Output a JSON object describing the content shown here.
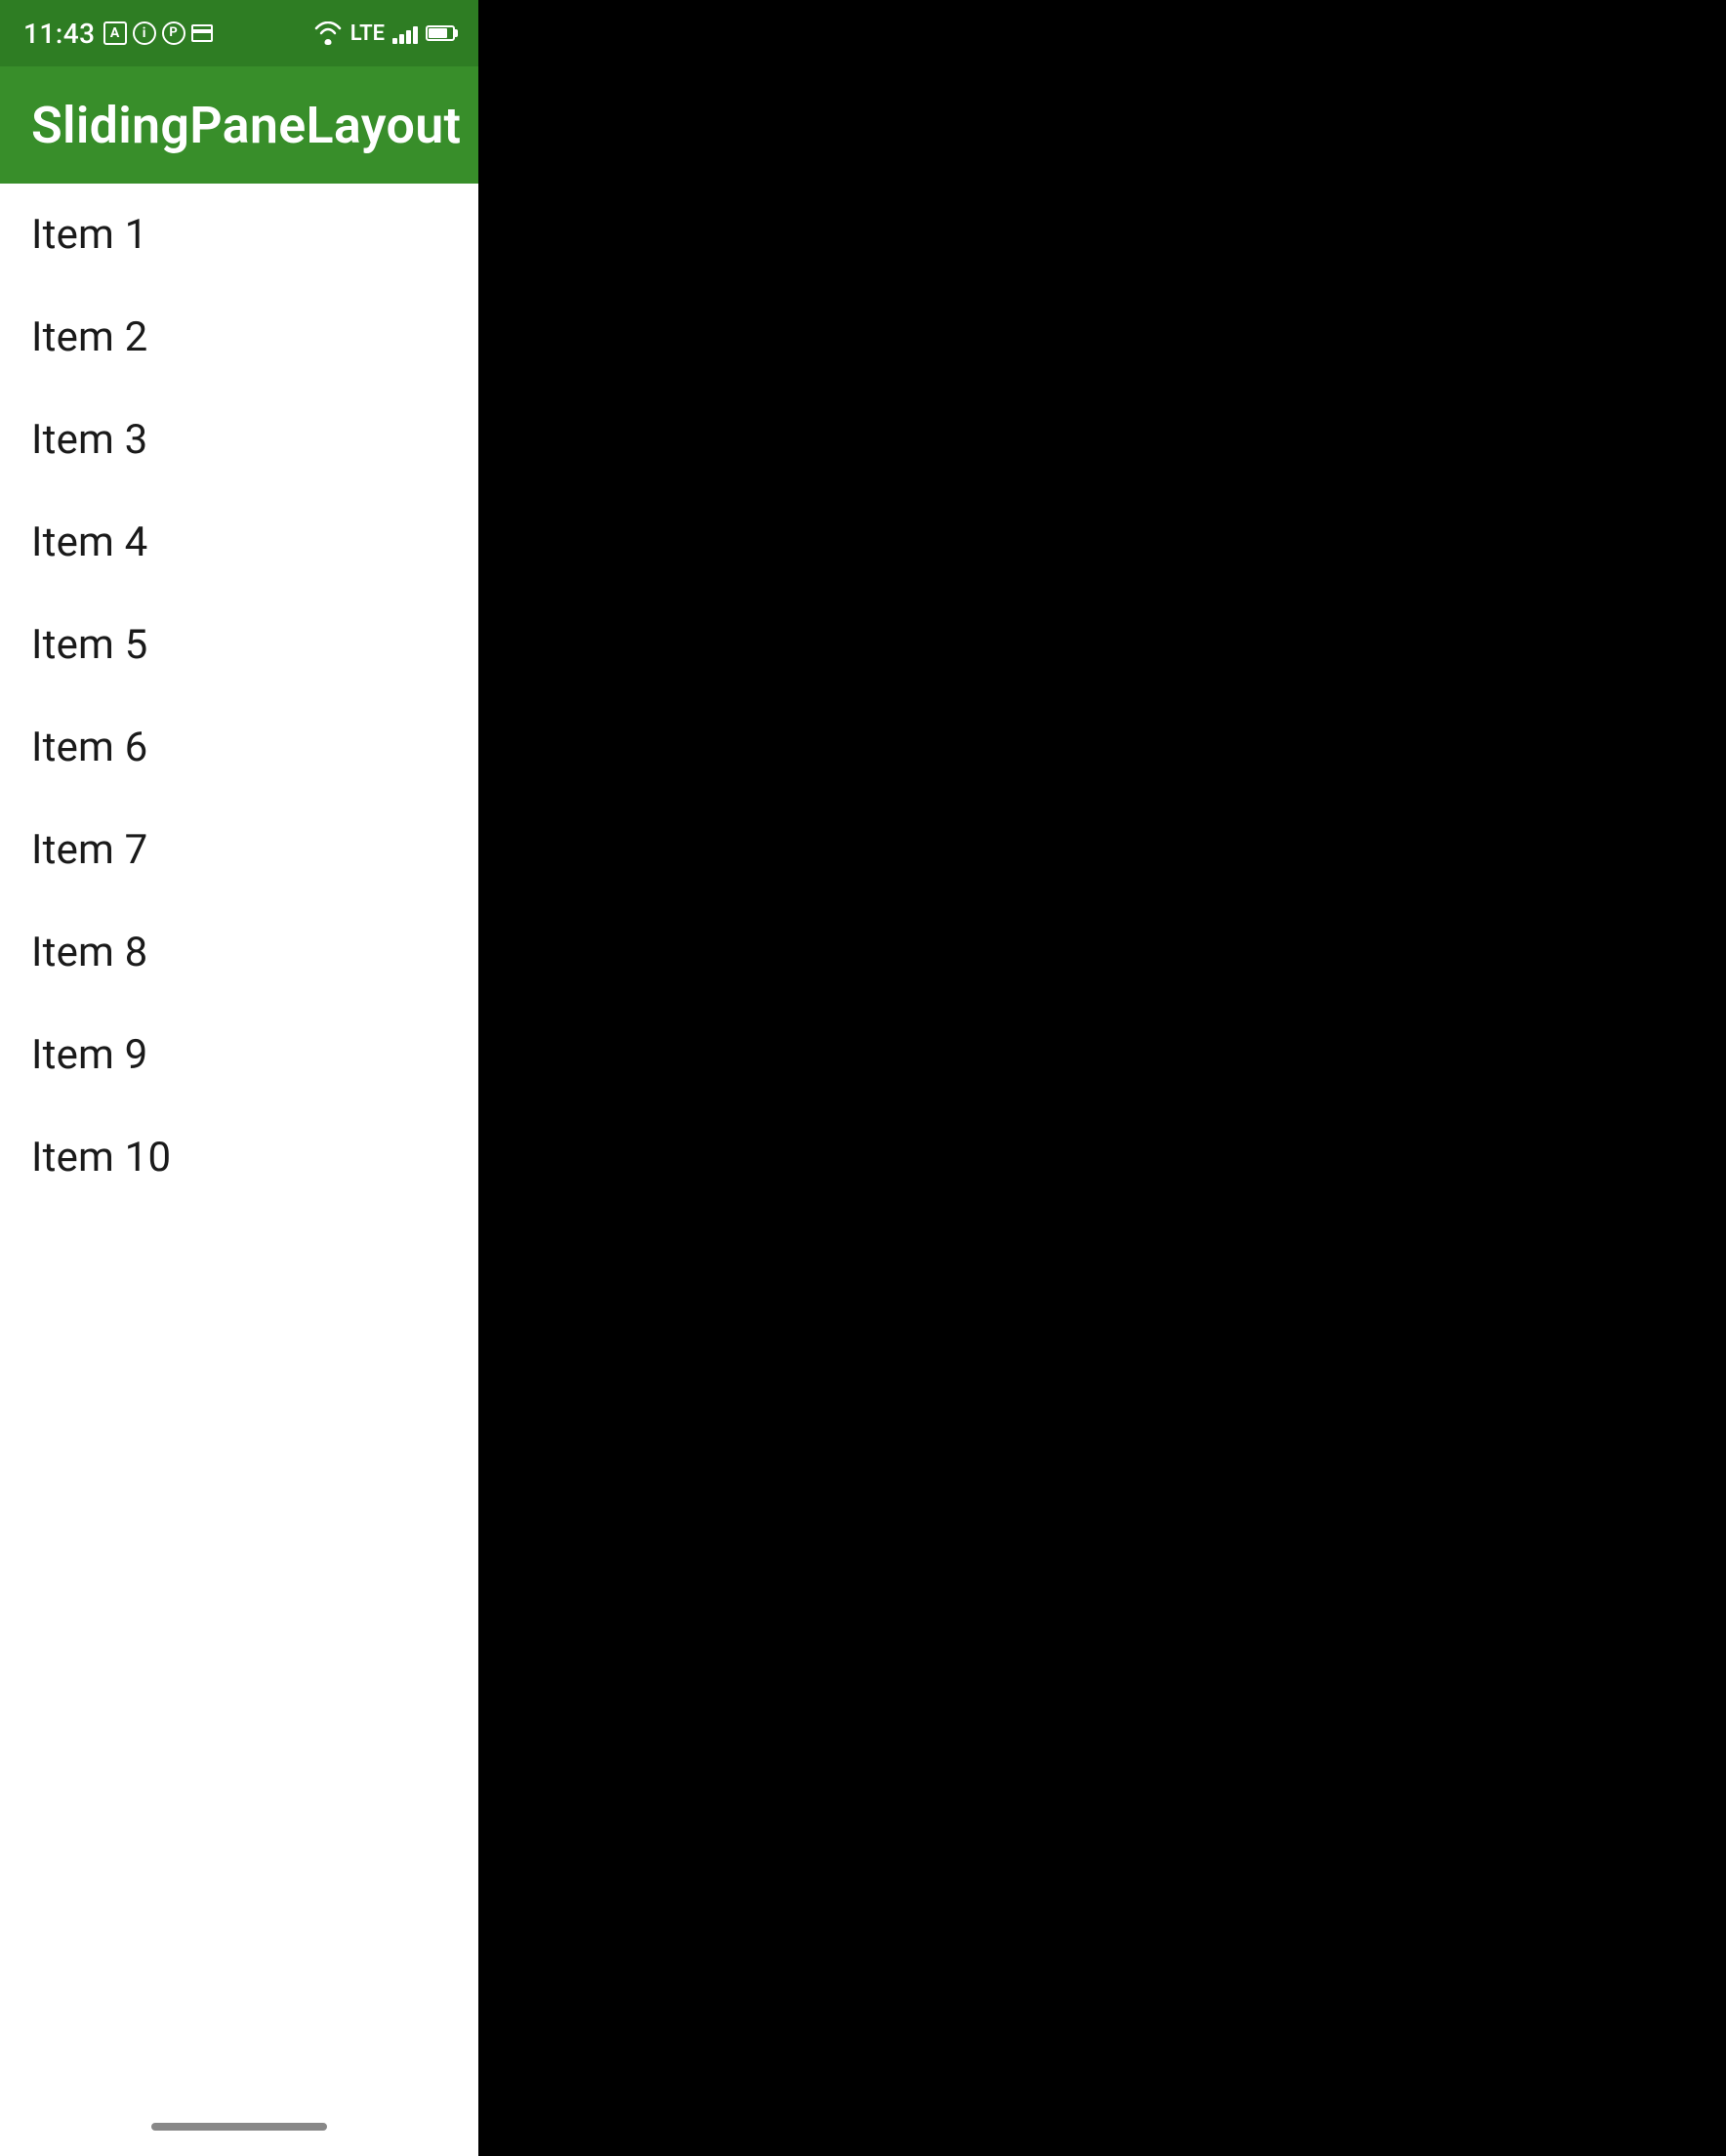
{
  "statusBar": {
    "time": "11:43",
    "icons": [
      "A",
      "i",
      "P",
      "card"
    ],
    "lte": "LTE"
  },
  "appBar": {
    "title": "SlidingPaneLayout"
  },
  "list": {
    "items": [
      {
        "label": "Item 1"
      },
      {
        "label": "Item 2"
      },
      {
        "label": "Item 3"
      },
      {
        "label": "Item 4"
      },
      {
        "label": "Item 5"
      },
      {
        "label": "Item 6"
      },
      {
        "label": "Item 7"
      },
      {
        "label": "Item 8"
      },
      {
        "label": "Item 9"
      },
      {
        "label": "Item 10"
      }
    ]
  },
  "colors": {
    "statusBar": "#2e7d23",
    "appBar": "#388e2a",
    "background": "#000000",
    "panelBg": "#ffffff",
    "titleText": "#ffffff",
    "itemText": "#1a1a1a"
  }
}
